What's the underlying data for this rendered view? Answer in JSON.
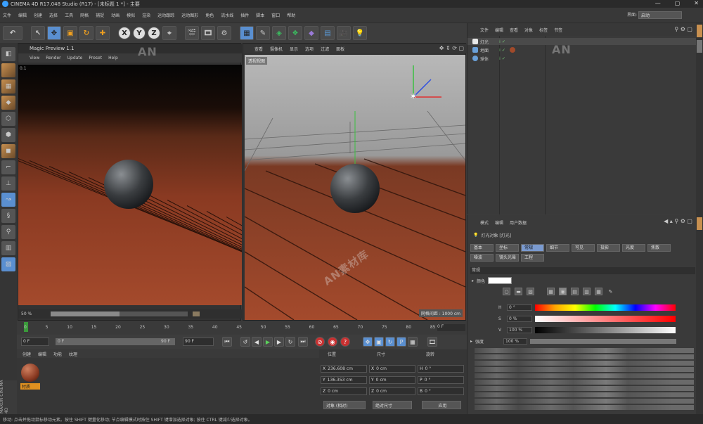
{
  "app": {
    "title": "CINEMA 4D R17.048 Studio (R17) - [未标题 1 *] - 主要",
    "window_controls": [
      "—",
      "▢",
      "✕"
    ]
  },
  "menubar": {
    "items": [
      "文件",
      "编辑",
      "创建",
      "选择",
      "工具",
      "网格",
      "捕捉",
      "动画",
      "模拟",
      "渲染",
      "运动跟踪",
      "运动图形",
      "角色",
      "流水线",
      "插件",
      "脚本",
      "窗口",
      "帮助"
    ],
    "layout_label": "界面:",
    "layout_value": "启动"
  },
  "toolbar": {
    "undo_icon": "undo-icon",
    "xyz": [
      "X",
      "Y",
      "Z"
    ]
  },
  "magic_preview": {
    "title": "Magic Preview 1.1",
    "menu": [
      "View",
      "Render",
      "Update",
      "Preset",
      "Help"
    ],
    "corner_label": "0.1",
    "zoom": "50 %",
    "progress": 0.5
  },
  "viewport": {
    "menu": [
      "查看",
      "摄像机",
      "显示",
      "选项",
      "过滤",
      "面板"
    ],
    "label": "透视视图",
    "grid_note": "网格间距 : 1000 cm"
  },
  "timeline": {
    "ticks": [
      "0",
      "5",
      "10",
      "15",
      "20",
      "25",
      "30",
      "35",
      "40",
      "45",
      "50",
      "55",
      "60",
      "65",
      "70",
      "75",
      "80",
      "85",
      "90"
    ],
    "end_label": "0 F"
  },
  "transport": {
    "start": "0 F",
    "current": "0 F",
    "range_end": "90 F",
    "end": "90 F"
  },
  "material_panel": {
    "menu": [
      "创建",
      "编辑",
      "功能",
      "纹理"
    ],
    "material_name": "材质"
  },
  "maxon": "MAXON CINEMA 4D",
  "coordinates": {
    "headers": [
      "位置",
      "尺寸",
      "旋转"
    ],
    "rows": [
      {
        "axis": "X",
        "pos": "236.608 cm",
        "size_axis": "X",
        "size": "0 cm",
        "rot_axis": "H",
        "rot": "0 °"
      },
      {
        "axis": "Y",
        "pos": "136.353 cm",
        "size_axis": "Y",
        "size": "0 cm",
        "rot_axis": "P",
        "rot": "0 °"
      },
      {
        "axis": "Z",
        "pos": "0 cm",
        "size_axis": "Z",
        "size": "0 cm",
        "rot_axis": "B",
        "rot": "0 °"
      }
    ],
    "mode": "对象 (相对)",
    "size_mode": "绝对尺寸",
    "apply": "应用"
  },
  "status": "移动: 点击并拖动鼠标移动元素。按住 SHIFT 键量化移动; 节点编辑模式时按住 SHIFT 键增加选择对象; 按住 CTRL 键减少选择对象。",
  "objects_panel": {
    "menu": [
      "文件",
      "编辑",
      "查看",
      "对象",
      "标签",
      "书签"
    ],
    "objects": [
      {
        "name": "灯光",
        "color": "#d8d8d8"
      },
      {
        "name": "地面",
        "color": "#6aa0d8"
      },
      {
        "name": "球体",
        "color": "#6aa0d8"
      }
    ]
  },
  "attributes_panel": {
    "menu": [
      "模式",
      "编辑",
      "用户数据"
    ],
    "title": "灯光对象 [灯光]",
    "tabs_row1": [
      "基本",
      "坐标",
      "常规",
      "细节",
      "可见",
      "投影",
      "光度",
      "焦散"
    ],
    "tabs_row2": [
      "噪波",
      "镜头光晕",
      "工程"
    ],
    "active_tab": "常规",
    "section": "常规",
    "color_label": "颜色",
    "h_label": "H",
    "h_value": "0 °",
    "s_label": "S",
    "s_value": "0 %",
    "v_label": "V",
    "v_value": "100 %",
    "intensity_label": "强度",
    "intensity_value": "100 %"
  },
  "watermark": "AN",
  "watermark2": "AN素材库",
  "colors": {
    "accent": "#5a8fd0",
    "highlight": "#e09020"
  }
}
